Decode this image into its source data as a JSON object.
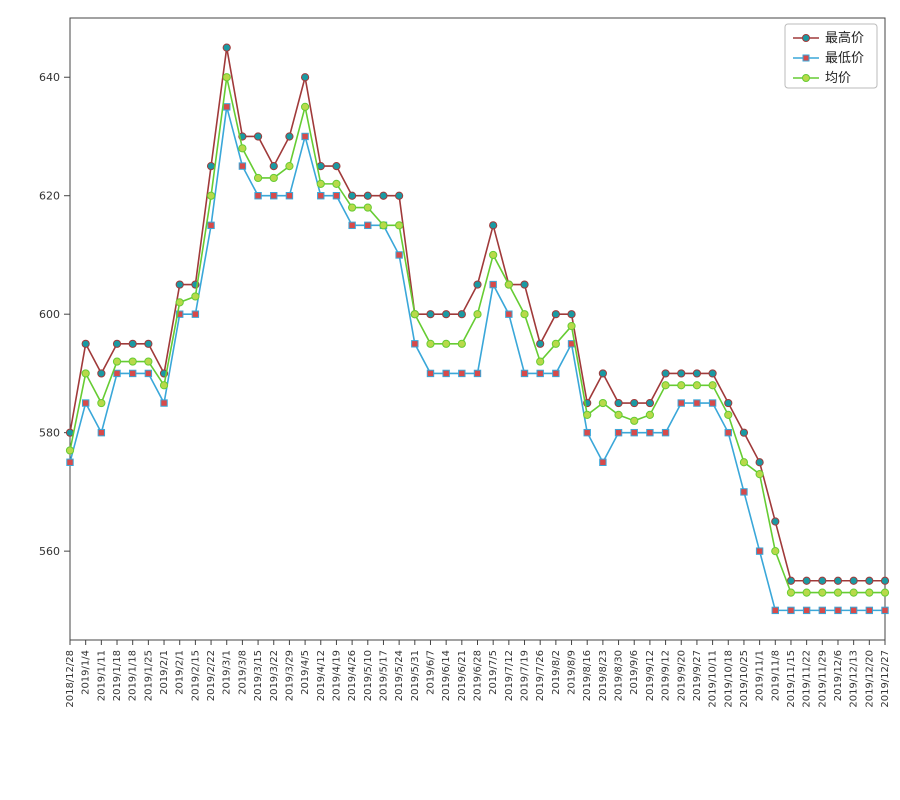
{
  "chart_data": {
    "type": "line",
    "categories": [
      "2018/12/28",
      "2019/1/4",
      "2019/1/11",
      "2019/1/18",
      "2019/1/18",
      "2019/1/25",
      "2019/2/1",
      "2019/2/1",
      "2019/2/15",
      "2019/2/22",
      "2019/3/1",
      "2019/3/8",
      "2019/3/15",
      "2019/3/22",
      "2019/3/29",
      "2019/4/5",
      "2019/4/12",
      "2019/4/19",
      "2019/4/26",
      "2019/5/10",
      "2019/5/17",
      "2019/5/24",
      "2019/5/31",
      "2019/6/7",
      "2019/6/14",
      "2019/6/21",
      "2019/6/28",
      "2019/7/5",
      "2019/7/12",
      "2019/7/19",
      "2019/7/26",
      "2019/8/2",
      "2019/8/9",
      "2019/8/16",
      "2019/8/23",
      "2019/8/30",
      "2019/9/6",
      "2019/9/12",
      "2019/9/12",
      "2019/9/20",
      "2019/9/27",
      "2019/10/11",
      "2019/10/18",
      "2019/10/25",
      "2019/11/1",
      "2019/11/8",
      "2019/11/15",
      "2019/11/22",
      "2019/11/29",
      "2019/12/6",
      "2019/12/13",
      "2019/12/20",
      "2019/12/27"
    ],
    "series": [
      {
        "name": "最高价",
        "color": "#a03a3a",
        "marker": "#1a9aa3",
        "values": [
          580,
          595,
          590,
          595,
          595,
          595,
          590,
          605,
          605,
          625,
          645,
          630,
          630,
          625,
          630,
          640,
          625,
          625,
          620,
          620,
          620,
          620,
          600,
          600,
          600,
          600,
          605,
          615,
          605,
          605,
          595,
          600,
          600,
          585,
          590,
          585,
          585,
          585,
          590,
          590,
          590,
          590,
          585,
          580,
          575,
          565,
          555,
          555,
          555,
          555,
          555,
          555,
          555
        ]
      },
      {
        "name": "最低价",
        "color": "#3aa7d9",
        "marker": "#d84a4a",
        "values": [
          575,
          585,
          580,
          590,
          590,
          590,
          585,
          600,
          600,
          615,
          635,
          625,
          620,
          620,
          620,
          630,
          620,
          620,
          615,
          615,
          615,
          610,
          595,
          590,
          590,
          590,
          590,
          605,
          600,
          590,
          590,
          590,
          595,
          580,
          575,
          580,
          580,
          580,
          580,
          585,
          585,
          585,
          580,
          570,
          560,
          550,
          550,
          550,
          550,
          550,
          550,
          550,
          550
        ]
      },
      {
        "name": "均价",
        "color": "#66cc33",
        "marker": "#b8d94a",
        "values": [
          577,
          590,
          585,
          592,
          592,
          592,
          588,
          602,
          603,
          620,
          640,
          628,
          623,
          623,
          625,
          635,
          622,
          622,
          618,
          618,
          615,
          615,
          600,
          595,
          595,
          595,
          600,
          610,
          605,
          600,
          592,
          595,
          598,
          583,
          585,
          583,
          582,
          583,
          588,
          588,
          588,
          588,
          583,
          575,
          573,
          560,
          553,
          553,
          553,
          553,
          553,
          553,
          553
        ]
      }
    ],
    "ylabel": "",
    "xlabel": "",
    "title": "",
    "yticks": [
      560,
      580,
      600,
      620,
      640
    ],
    "ylim": [
      545,
      650
    ],
    "legend_position": "upper-right"
  },
  "watermark": ""
}
